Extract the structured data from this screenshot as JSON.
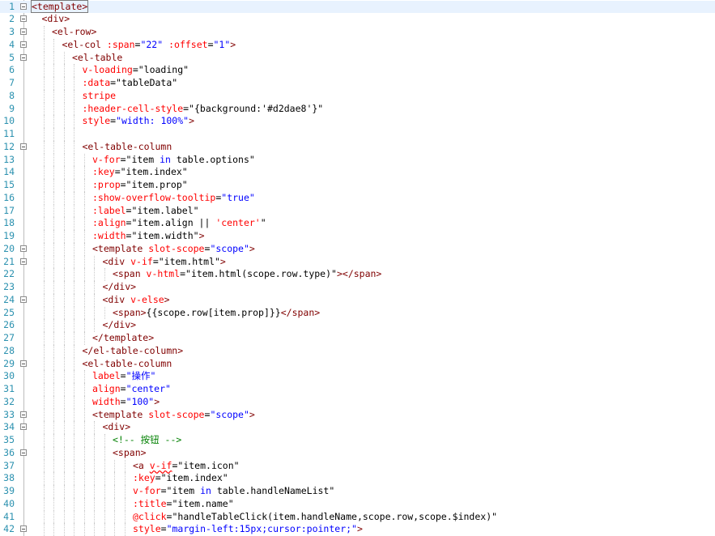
{
  "editor": {
    "language": "html-vue",
    "colors": {
      "line_number": "#2b91af",
      "tag": "#800000",
      "attribute": "#ff0000",
      "value": "#0000ff",
      "text": "#000000",
      "comment": "#008000",
      "current_line": "#e8f2fe"
    },
    "lines": [
      {
        "n": "1",
        "fold": true,
        "indent": 0,
        "segs": [
          {
            "c": "tag",
            "t": "<template>"
          }
        ]
      },
      {
        "n": "2",
        "fold": true,
        "indent": 1,
        "segs": [
          {
            "c": "tag",
            "t": "<div>"
          }
        ]
      },
      {
        "n": "3",
        "fold": true,
        "indent": 2,
        "segs": [
          {
            "c": "tag",
            "t": "<el-row>"
          }
        ]
      },
      {
        "n": "4",
        "fold": true,
        "indent": 3,
        "segs": [
          {
            "c": "tag",
            "t": "<el-col "
          },
          {
            "c": "attr",
            "t": ":span"
          },
          {
            "c": "txt",
            "t": "="
          },
          {
            "c": "val",
            "t": "\"22\""
          },
          {
            "c": "txt",
            "t": " "
          },
          {
            "c": "attr",
            "t": ":offset"
          },
          {
            "c": "txt",
            "t": "="
          },
          {
            "c": "val",
            "t": "\"1\""
          },
          {
            "c": "tag",
            "t": ">"
          }
        ]
      },
      {
        "n": "5",
        "fold": true,
        "indent": 4,
        "segs": [
          {
            "c": "tag",
            "t": "<el-table"
          }
        ]
      },
      {
        "n": "6",
        "fold": false,
        "indent": 5,
        "segs": [
          {
            "c": "attr",
            "t": "v-loading"
          },
          {
            "c": "txt",
            "t": "=\"loading\""
          }
        ]
      },
      {
        "n": "7",
        "fold": false,
        "indent": 5,
        "segs": [
          {
            "c": "attr",
            "t": ":data"
          },
          {
            "c": "txt",
            "t": "=\"tableData\""
          }
        ]
      },
      {
        "n": "8",
        "fold": false,
        "indent": 5,
        "segs": [
          {
            "c": "attr",
            "t": "stripe"
          }
        ]
      },
      {
        "n": "9",
        "fold": false,
        "indent": 5,
        "segs": [
          {
            "c": "attr",
            "t": ":header-cell-style"
          },
          {
            "c": "txt",
            "t": "=\"{background:'#d2dae8'}\""
          }
        ]
      },
      {
        "n": "10",
        "fold": false,
        "indent": 5,
        "segs": [
          {
            "c": "attr",
            "t": "style"
          },
          {
            "c": "txt",
            "t": "="
          },
          {
            "c": "val",
            "t": "\"width: 100%\""
          },
          {
            "c": "tag",
            "t": ">"
          }
        ]
      },
      {
        "n": "11",
        "fold": false,
        "indent": 5,
        "segs": []
      },
      {
        "n": "12",
        "fold": true,
        "indent": 5,
        "segs": [
          {
            "c": "tag",
            "t": "<el-table-column"
          }
        ]
      },
      {
        "n": "13",
        "fold": false,
        "indent": 6,
        "segs": [
          {
            "c": "attr",
            "t": "v-for"
          },
          {
            "c": "txt",
            "t": "=\"item "
          },
          {
            "c": "val",
            "t": "in"
          },
          {
            "c": "txt",
            "t": " table.options\""
          }
        ]
      },
      {
        "n": "14",
        "fold": false,
        "indent": 6,
        "segs": [
          {
            "c": "attr",
            "t": ":key"
          },
          {
            "c": "txt",
            "t": "=\"item.index\""
          }
        ]
      },
      {
        "n": "15",
        "fold": false,
        "indent": 6,
        "segs": [
          {
            "c": "attr",
            "t": ":prop"
          },
          {
            "c": "txt",
            "t": "=\"item.prop\""
          }
        ]
      },
      {
        "n": "16",
        "fold": false,
        "indent": 6,
        "segs": [
          {
            "c": "attr",
            "t": ":show-overflow-tooltip"
          },
          {
            "c": "txt",
            "t": "="
          },
          {
            "c": "val",
            "t": "\"true\""
          }
        ]
      },
      {
        "n": "17",
        "fold": false,
        "indent": 6,
        "segs": [
          {
            "c": "attr",
            "t": ":label"
          },
          {
            "c": "txt",
            "t": "=\"item.label\""
          }
        ]
      },
      {
        "n": "18",
        "fold": false,
        "indent": 6,
        "segs": [
          {
            "c": "attr",
            "t": ":align"
          },
          {
            "c": "txt",
            "t": "=\"item.align || "
          },
          {
            "c": "attr",
            "t": "'center'"
          },
          {
            "c": "txt",
            "t": "\""
          }
        ]
      },
      {
        "n": "19",
        "fold": false,
        "indent": 6,
        "segs": [
          {
            "c": "attr",
            "t": ":width"
          },
          {
            "c": "txt",
            "t": "=\"item.width\""
          },
          {
            "c": "tag",
            "t": ">"
          }
        ]
      },
      {
        "n": "20",
        "fold": true,
        "indent": 6,
        "segs": [
          {
            "c": "tag",
            "t": "<template "
          },
          {
            "c": "attr",
            "t": "slot-scope"
          },
          {
            "c": "txt",
            "t": "="
          },
          {
            "c": "val",
            "t": "\"scope\""
          },
          {
            "c": "tag",
            "t": ">"
          }
        ]
      },
      {
        "n": "21",
        "fold": true,
        "indent": 7,
        "segs": [
          {
            "c": "tag",
            "t": "<div "
          },
          {
            "c": "attr",
            "t": "v-if"
          },
          {
            "c": "txt",
            "t": "=\"item.html\""
          },
          {
            "c": "tag",
            "t": ">"
          }
        ]
      },
      {
        "n": "22",
        "fold": false,
        "indent": 8,
        "segs": [
          {
            "c": "tag",
            "t": "<span "
          },
          {
            "c": "attr",
            "t": "v-html"
          },
          {
            "c": "txt",
            "t": "=\"item.html(scope.row.type)\""
          },
          {
            "c": "tag",
            "t": "></span>"
          }
        ]
      },
      {
        "n": "23",
        "fold": false,
        "indent": 7,
        "segs": [
          {
            "c": "tag",
            "t": "</div>"
          }
        ]
      },
      {
        "n": "24",
        "fold": true,
        "indent": 7,
        "segs": [
          {
            "c": "tag",
            "t": "<div "
          },
          {
            "c": "attr",
            "t": "v-else"
          },
          {
            "c": "tag",
            "t": ">"
          }
        ]
      },
      {
        "n": "25",
        "fold": false,
        "indent": 8,
        "segs": [
          {
            "c": "tag",
            "t": "<span>"
          },
          {
            "c": "txt",
            "t": "{{scope.row[item.prop]}}"
          },
          {
            "c": "tag",
            "t": "</span>"
          }
        ]
      },
      {
        "n": "26",
        "fold": false,
        "indent": 7,
        "segs": [
          {
            "c": "tag",
            "t": "</div>"
          }
        ]
      },
      {
        "n": "27",
        "fold": false,
        "indent": 6,
        "segs": [
          {
            "c": "tag",
            "t": "</template>"
          }
        ]
      },
      {
        "n": "28",
        "fold": false,
        "indent": 5,
        "segs": [
          {
            "c": "tag",
            "t": "</el-table-column>"
          }
        ]
      },
      {
        "n": "29",
        "fold": true,
        "indent": 5,
        "segs": [
          {
            "c": "tag",
            "t": "<el-table-column"
          }
        ]
      },
      {
        "n": "30",
        "fold": false,
        "indent": 6,
        "segs": [
          {
            "c": "attr",
            "t": "label"
          },
          {
            "c": "txt",
            "t": "="
          },
          {
            "c": "val",
            "t": "\"操作\""
          }
        ]
      },
      {
        "n": "31",
        "fold": false,
        "indent": 6,
        "segs": [
          {
            "c": "attr",
            "t": "align"
          },
          {
            "c": "txt",
            "t": "="
          },
          {
            "c": "val",
            "t": "\"center\""
          }
        ]
      },
      {
        "n": "32",
        "fold": false,
        "indent": 6,
        "segs": [
          {
            "c": "attr",
            "t": "width"
          },
          {
            "c": "txt",
            "t": "="
          },
          {
            "c": "val",
            "t": "\"100\""
          },
          {
            "c": "tag",
            "t": ">"
          }
        ]
      },
      {
        "n": "33",
        "fold": true,
        "indent": 6,
        "segs": [
          {
            "c": "tag",
            "t": "<template "
          },
          {
            "c": "attr",
            "t": "slot-scope"
          },
          {
            "c": "txt",
            "t": "="
          },
          {
            "c": "val",
            "t": "\"scope\""
          },
          {
            "c": "tag",
            "t": ">"
          }
        ]
      },
      {
        "n": "34",
        "fold": true,
        "indent": 7,
        "segs": [
          {
            "c": "tag",
            "t": "<div>"
          }
        ]
      },
      {
        "n": "35",
        "fold": false,
        "indent": 8,
        "segs": [
          {
            "c": "cmt",
            "t": "<!-- 按钮 -->"
          }
        ]
      },
      {
        "n": "36",
        "fold": true,
        "indent": 8,
        "segs": [
          {
            "c": "tag",
            "t": "<span>"
          }
        ]
      },
      {
        "n": "37",
        "fold": false,
        "indent": 10,
        "segs": [
          {
            "c": "tag",
            "t": "<a "
          },
          {
            "c": "attr squiggle",
            "t": "v-if"
          },
          {
            "c": "txt",
            "t": "=\"item.icon\""
          }
        ]
      },
      {
        "n": "38",
        "fold": false,
        "indent": 10,
        "segs": [
          {
            "c": "attr",
            "t": ":key"
          },
          {
            "c": "txt",
            "t": "=\"item.index\""
          }
        ]
      },
      {
        "n": "39",
        "fold": false,
        "indent": 10,
        "segs": [
          {
            "c": "attr",
            "t": "v-for"
          },
          {
            "c": "txt",
            "t": "=\"item "
          },
          {
            "c": "val",
            "t": "in"
          },
          {
            "c": "txt",
            "t": " table.handleNameList\""
          }
        ]
      },
      {
        "n": "40",
        "fold": false,
        "indent": 10,
        "segs": [
          {
            "c": "attr",
            "t": ":title"
          },
          {
            "c": "txt",
            "t": "=\"item.name\""
          }
        ]
      },
      {
        "n": "41",
        "fold": false,
        "indent": 10,
        "segs": [
          {
            "c": "attr",
            "t": "@click"
          },
          {
            "c": "txt",
            "t": "=\"handleTableClick(item.handleName,scope.row,scope.$index)\""
          }
        ]
      },
      {
        "n": "42",
        "fold": true,
        "indent": 10,
        "segs": [
          {
            "c": "attr",
            "t": "style"
          },
          {
            "c": "txt",
            "t": "="
          },
          {
            "c": "val",
            "t": "\"margin-left:15px;cursor:pointer;\""
          },
          {
            "c": "tag",
            "t": ">"
          }
        ]
      }
    ]
  }
}
